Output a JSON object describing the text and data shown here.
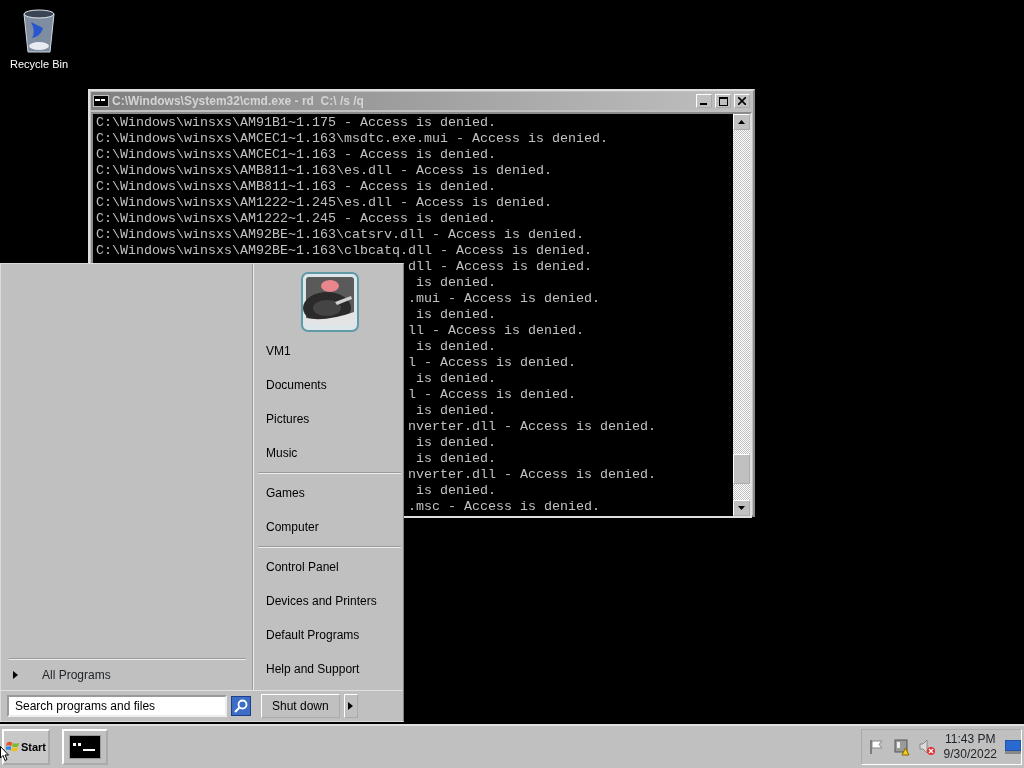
{
  "desktop": {
    "icons": [
      {
        "label": "Recycle Bin"
      }
    ]
  },
  "console_window": {
    "title": "C:\\Windows\\System32\\cmd.exe - rd  C:\\ /s /q",
    "lines": [
      {
        "kind": "full",
        "text": "C:\\Windows\\winsxs\\AM91B1~1.175 - Access is denied."
      },
      {
        "kind": "full",
        "text": "C:\\Windows\\winsxs\\AMCEC1~1.163\\msdtc.exe.mui - Access is denied."
      },
      {
        "kind": "full",
        "text": "C:\\Windows\\winsxs\\AMCEC1~1.163 - Access is denied."
      },
      {
        "kind": "full",
        "text": "C:\\Windows\\winsxs\\AMB811~1.163\\es.dll - Access is denied."
      },
      {
        "kind": "full",
        "text": "C:\\Windows\\winsxs\\AMB811~1.163 - Access is denied."
      },
      {
        "kind": "full",
        "text": "C:\\Windows\\winsxs\\AM1222~1.245\\es.dll - Access is denied."
      },
      {
        "kind": "full",
        "text": "C:\\Windows\\winsxs\\AM1222~1.245 - Access is denied."
      },
      {
        "kind": "full",
        "text": "C:\\Windows\\winsxs\\AM92BE~1.163\\catsrv.dll - Access is denied."
      },
      {
        "kind": "full",
        "text": "C:\\Windows\\winsxs\\AM92BE~1.163\\clbcatq.dll - Access is denied."
      },
      {
        "kind": "cut",
        "text": "dll - Access is denied."
      },
      {
        "kind": "cut",
        "text": " is denied."
      },
      {
        "kind": "cut",
        "text": ".mui - Access is denied."
      },
      {
        "kind": "cut",
        "text": " is denied."
      },
      {
        "kind": "cut",
        "text": "ll - Access is denied."
      },
      {
        "kind": "cut",
        "text": " is denied."
      },
      {
        "kind": "cut",
        "text": "l - Access is denied."
      },
      {
        "kind": "cut",
        "text": " is denied."
      },
      {
        "kind": "cut",
        "text": "l - Access is denied."
      },
      {
        "kind": "cut",
        "text": " is denied."
      },
      {
        "kind": "cut",
        "text": "nverter.dll - Access is denied."
      },
      {
        "kind": "cut",
        "text": " is denied."
      },
      {
        "kind": "cut",
        "text": " is denied."
      },
      {
        "kind": "cut",
        "text": "nverter.dll - Access is denied."
      },
      {
        "kind": "cut",
        "text": " is denied."
      },
      {
        "kind": "cut",
        "text": ".msc - Access is denied."
      }
    ]
  },
  "start_menu": {
    "right_groups": [
      [
        "VM1",
        "Documents",
        "Pictures",
        "Music"
      ],
      [
        "Games",
        "Computer"
      ],
      [
        "Control Panel",
        "Devices and Printers",
        "Default Programs",
        "Help and Support"
      ]
    ],
    "all_programs": "All Programs",
    "search": {
      "placeholder": "Search programs and files"
    },
    "shutdown": "Shut down"
  },
  "taskbar": {
    "start": "Start",
    "clock": {
      "time": "11:43 PM",
      "date": "9/30/2022"
    }
  }
}
